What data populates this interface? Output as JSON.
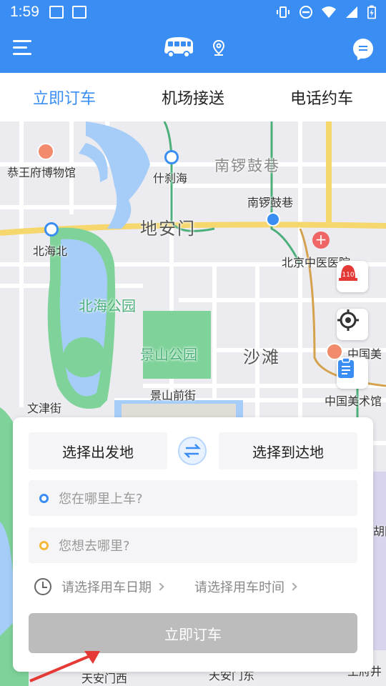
{
  "status_bar": {
    "time": "1:59"
  },
  "tabs": [
    {
      "label": "立即订车",
      "active": true
    },
    {
      "label": "机场接送",
      "active": false
    },
    {
      "label": "电话约车",
      "active": false
    }
  ],
  "map": {
    "labels": {
      "gongwangfu": "恭王府博物馆",
      "shichahai": "什刹海",
      "nanluoguxiang_area": "南锣鼓巷",
      "nanluoguxiang_station": "南锣鼓巷",
      "dianmen": "地安门",
      "beihaibei": "北海北",
      "zhongyi": "北京中医医院",
      "beihai_park": "北海公园",
      "jingshan_park": "景山公园",
      "shatan": "沙滩",
      "meishuguan_top": "中国美",
      "meishuguan": "中国美术馆",
      "jingshanqianjie": "景山前街",
      "wenjinjie": "文津街",
      "tiananmen_west": "天安门西",
      "tiananmen_east": "天安门东",
      "right_edge_1": "胡同",
      "right_edge_2": "王府井"
    },
    "alarm_label": "110"
  },
  "booking": {
    "from_button": "选择出发地",
    "to_button": "选择到达地",
    "pickup_placeholder": "您在哪里上车?",
    "dest_placeholder": "您想去哪里?",
    "date_picker": "请选择用车日期",
    "time_picker": "请选择用车时间",
    "submit": "立即订车"
  },
  "colors": {
    "primary": "#3a8ef3",
    "submit_disabled": "#bcbcbc",
    "pickup_dot": "#3a8ef3",
    "dest_dot": "#f5b73b",
    "park_green": "#7fd39a",
    "water_blue": "#a5cdf8",
    "ring_road_yellow": "#f5d76e"
  }
}
